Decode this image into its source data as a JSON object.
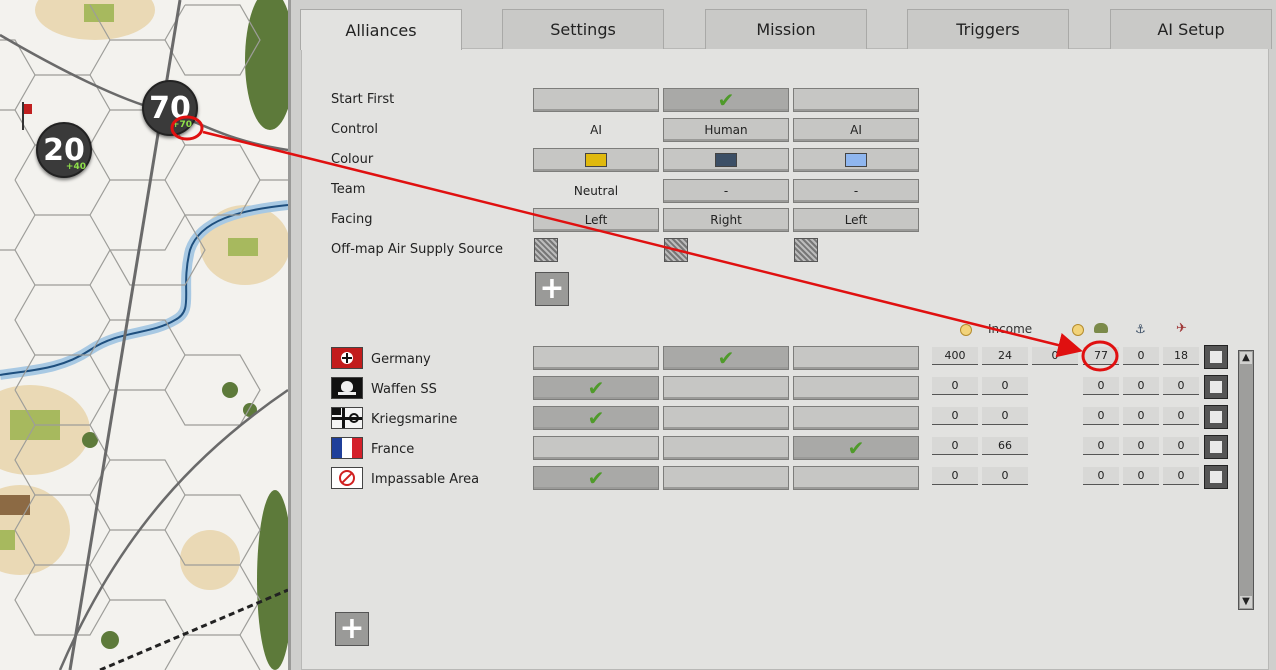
{
  "map": {
    "units": [
      {
        "value": "70",
        "bonus": "+70"
      },
      {
        "value": "20",
        "bonus": "+40"
      }
    ]
  },
  "tabs": [
    {
      "label": "Alliances",
      "active": true
    },
    {
      "label": "Settings"
    },
    {
      "label": "Mission"
    },
    {
      "label": "Triggers"
    },
    {
      "label": "AI Setup"
    }
  ],
  "rows": {
    "start_first": "Start First",
    "control": "Control",
    "colour": "Colour",
    "team": "Team",
    "facing": "Facing",
    "air_supply": "Off-map Air Supply Source"
  },
  "control_values": [
    "AI",
    "Human",
    "AI"
  ],
  "team_values": [
    "Neutral",
    "-",
    "-"
  ],
  "facing_values": [
    "Left",
    "Right",
    "Left"
  ],
  "colours": [
    "#e0b90e",
    "#3c4f66",
    "#8fb6ef"
  ],
  "income_label": "Income",
  "factions": [
    {
      "name": "Germany",
      "check_col": 2,
      "values": [
        "400",
        "24",
        "0",
        "77",
        "0",
        "18"
      ]
    },
    {
      "name": "Waffen SS",
      "check_col": 1,
      "values": [
        "0",
        "0",
        "",
        "0",
        "0",
        "0"
      ]
    },
    {
      "name": "Kriegsmarine",
      "check_col": 1,
      "values": [
        "0",
        "0",
        "",
        "0",
        "0",
        "0"
      ]
    },
    {
      "name": "France",
      "check_col": 3,
      "values": [
        "0",
        "66",
        "",
        "0",
        "0",
        "0"
      ]
    },
    {
      "name": "Impassable Area",
      "check_col": 1,
      "values": [
        "0",
        "0",
        "",
        "0",
        "0",
        "0"
      ]
    }
  ],
  "icons": {
    "check": "✔",
    "plus": "+"
  },
  "colors": {
    "accent_red": "#e01010",
    "check_green": "#4f9a2a"
  }
}
